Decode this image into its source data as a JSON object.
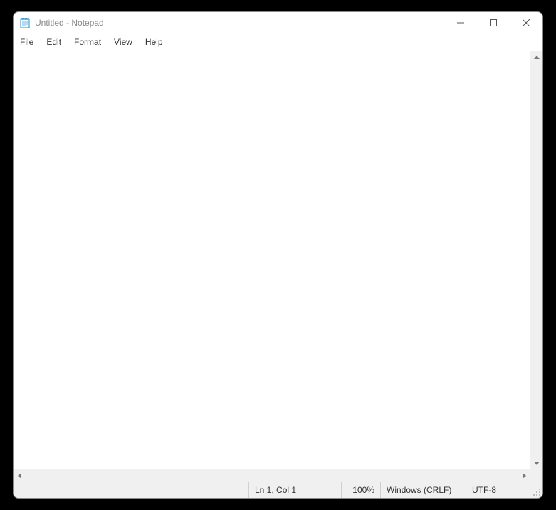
{
  "window": {
    "title": "Untitled - Notepad"
  },
  "menubar": {
    "items": [
      "File",
      "Edit",
      "Format",
      "View",
      "Help"
    ]
  },
  "editor": {
    "content": ""
  },
  "statusbar": {
    "position": "Ln 1, Col 1",
    "zoom": "100%",
    "line_ending": "Windows (CRLF)",
    "encoding": "UTF-8"
  }
}
